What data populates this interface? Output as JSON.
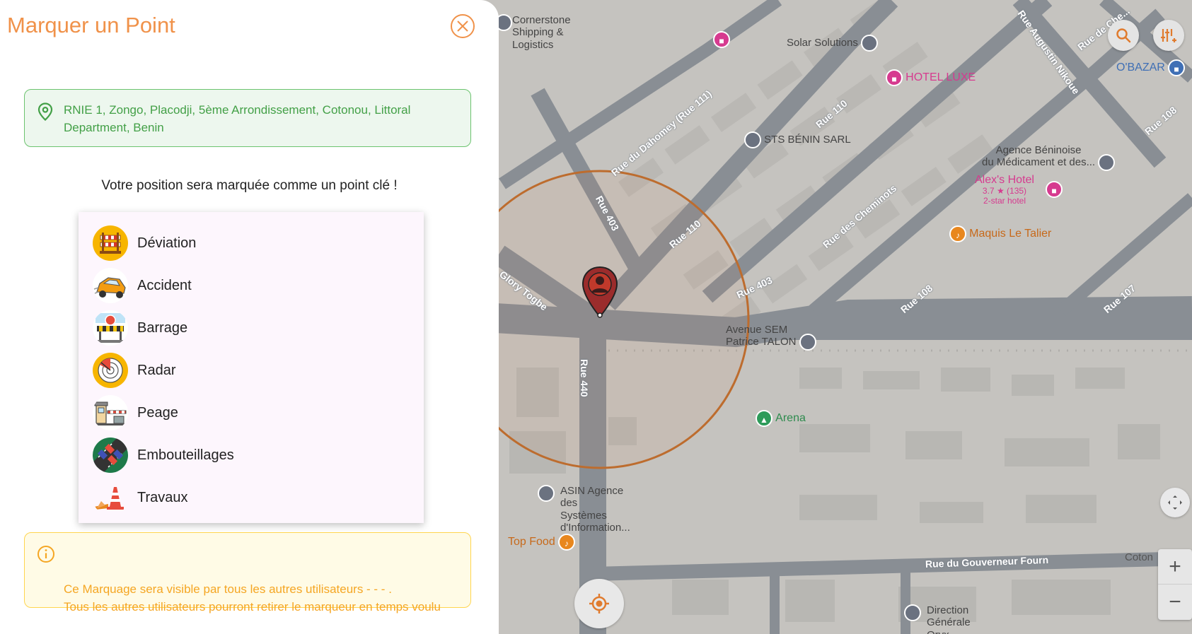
{
  "panel": {
    "title": "Marquer un Point",
    "address": "RNIE 1, Zongo, Placodji, 5ème Arrondissement, Cotonou, Littoral Department, Benin",
    "subtitle": "Votre position sera marquée comme un point clé !",
    "menu": [
      {
        "label": "Déviation",
        "icon": "deviation-barrier-icon"
      },
      {
        "label": "Accident",
        "icon": "car-crash-icon"
      },
      {
        "label": "Barrage",
        "icon": "police-roadblock-icon"
      },
      {
        "label": "Radar",
        "icon": "radar-icon"
      },
      {
        "label": "Peage",
        "icon": "toll-booth-icon"
      },
      {
        "label": "Embouteillages",
        "icon": "traffic-jam-icon"
      },
      {
        "label": "Travaux",
        "icon": "road-cones-icon"
      }
    ],
    "info": "Ce Marquage sera visible par tous les autres utilisateurs   - - - .\n Tous les autres utilisateurs pourront retirer le marqueur en temps voulu"
  },
  "map": {
    "places": {
      "cornerstone": "Cornerstone\nShipping & Logistics",
      "solar": "Solar Solutions",
      "hotel_luxe": "HOTEL LUXE",
      "obazar": "O'BAZAR",
      "sts": "STS BÉNIN SARL",
      "agence": "Agence Béninoise\ndu Médicament et des...",
      "alexs_hotel": "Alex's Hotel",
      "alexs_rating": "3.7 ★ (135)",
      "alexs_class": "2-star hotel",
      "maquis": "Maquis Le Talier",
      "avenue_sem": "Avenue SEM\nPatrice TALON",
      "arena": "Arena",
      "asin": "ASIN Agence des\nSystèmes d'Information...",
      "top_food": "Top Food",
      "direction": "Direction Générale\nOryx Bénin SA",
      "coton": "Coton"
    },
    "roads": {
      "augustin": "Rue Augustin Nikoue",
      "dahomey": "Rue du Dahomey (Rue 111)",
      "rue110a": "Rue 110",
      "rue110b": "Rue 110",
      "rue403a": "Rue 403",
      "rue403b": "Rue 403",
      "cheminots": "Rue des Cheminots",
      "rue108a": "Rue 108",
      "rue108b": "Rue 108",
      "rue107": "Rue 107",
      "rue440": "Rue 440",
      "togbe": "Glory Togbe",
      "gouverneur": "Rue du Gouverneur Fourn",
      "rue_che": "Rue de Che..."
    },
    "colors": {
      "accent": "#f0924a",
      "success": "#43a047",
      "warning": "#f5a623",
      "radius_circle": "#d9772b"
    }
  }
}
